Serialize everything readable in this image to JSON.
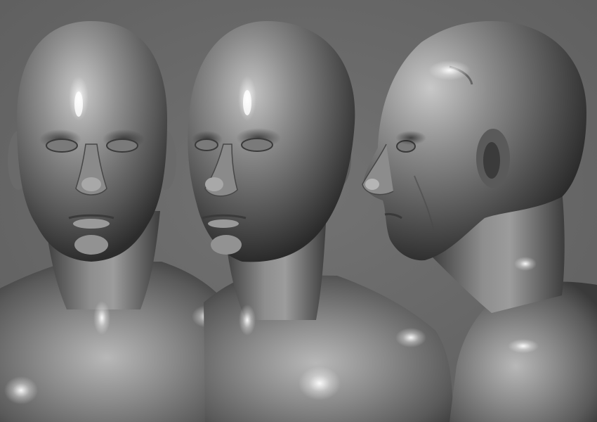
{
  "scene": {
    "views": [
      {
        "view": "front",
        "subject": "bust"
      },
      {
        "view": "three-quarter",
        "subject": "bust"
      },
      {
        "view": "profile",
        "subject": "bust"
      }
    ],
    "colors": {
      "background": "#6b6b6b",
      "clay_light": "#d8d8d8",
      "clay_mid": "#8e8e8e",
      "clay_dark": "#3a3a3a",
      "specular": "#ffffff"
    }
  }
}
